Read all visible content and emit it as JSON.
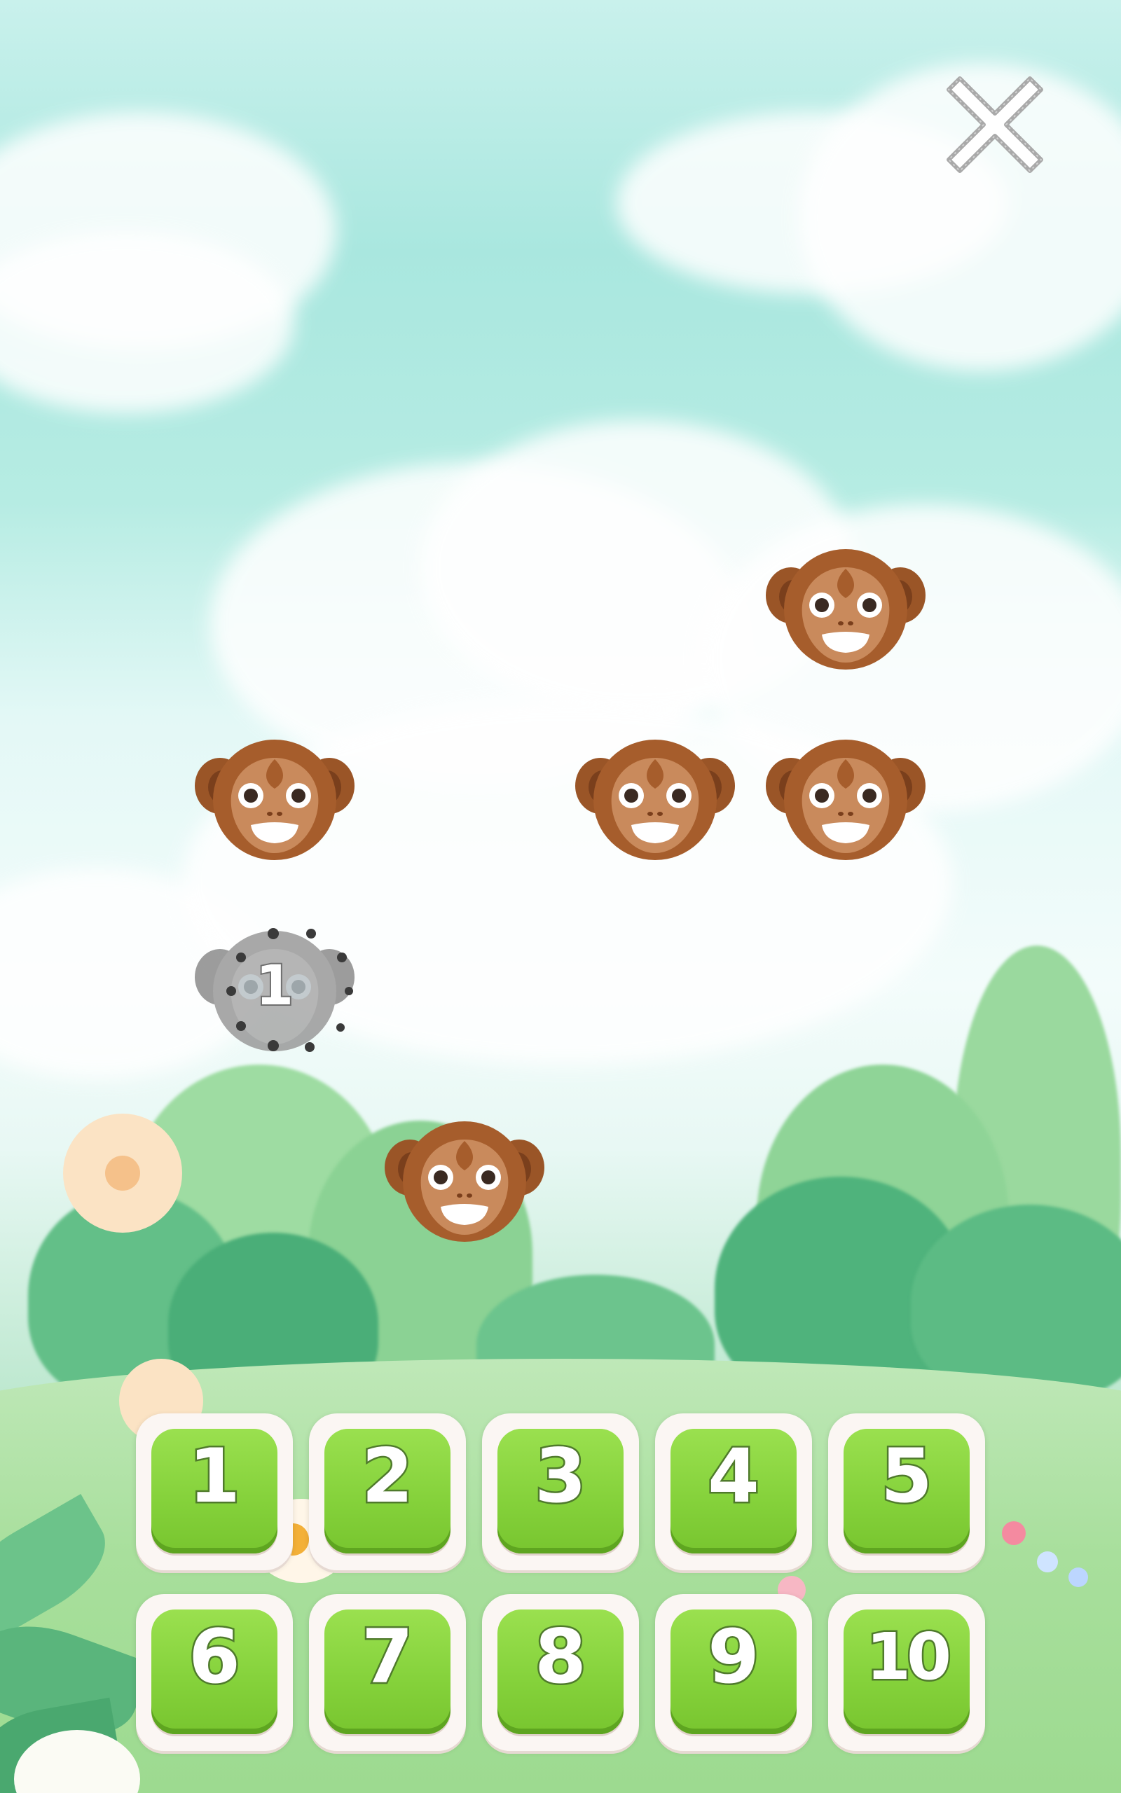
{
  "close_button": {
    "icon": "close-icon"
  },
  "monkeys": [
    {
      "state": "active"
    },
    {
      "state": "active"
    },
    {
      "state": "active"
    },
    {
      "state": "active"
    },
    {
      "state": "counted",
      "label": "1"
    },
    {
      "state": "active"
    }
  ],
  "answer_buttons": [
    {
      "label": "1"
    },
    {
      "label": "2"
    },
    {
      "label": "3"
    },
    {
      "label": "4"
    },
    {
      "label": "5"
    },
    {
      "label": "6"
    },
    {
      "label": "7"
    },
    {
      "label": "8"
    },
    {
      "label": "9"
    },
    {
      "label": "10"
    }
  ],
  "colors": {
    "button_green": "#84d13a",
    "button_frame": "#fbf6f3",
    "monkey_brown": "#a0592a",
    "monkey_face": "#c98a5c",
    "counted_gray": "#9a9a9a"
  }
}
